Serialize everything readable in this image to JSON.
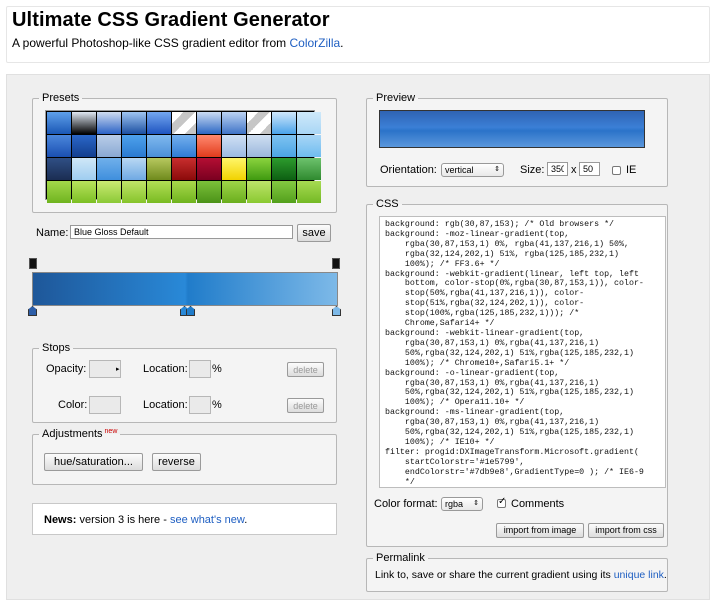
{
  "header": {
    "title": "Ultimate CSS Gradient Generator",
    "subtitle_prefix": "A powerful Photoshop-like CSS gradient editor from ",
    "subtitle_link": "ColorZilla",
    "subtitle_suffix": "."
  },
  "presets": {
    "legend": "Presets",
    "swatches": [
      "linear-gradient(#5fa0ea,#1a57b5)",
      "linear-gradient(#dfe7f2,#000)",
      "linear-gradient(#cfdcf0,#2a62c6)",
      "linear-gradient(#9fc5f2,#1b4fa1)",
      "linear-gradient(#74a7f0,#1e54c0)",
      "linear-gradient(135deg,#fff 25%,#c6c6c6 25%,#c6c6c6 50%,#fff 50%,#fff 75%,#c6c6c6 75%)",
      "linear-gradient(#cbdcf3,#2b67c4)",
      "linear-gradient(#bcd3f3,#3f73c7)",
      "linear-gradient(135deg,#fff 25%,#c6c6c6 25%,#c6c6c6 50%,#fff 50%,#fff 75%,#c6c6c6 75%)",
      "linear-gradient(#cfe7fb,#4aa3ea)",
      "linear-gradient(#cfe9fa,#a9d6f5)",
      "linear-gradient(#4b87dc,#1a4fb1)",
      "linear-gradient(#2b67c8,#123e8e)",
      "linear-gradient(#b9cde8,#8aa9d3)",
      "linear-gradient(#4ea2ec,#2a7ad1)",
      "linear-gradient(#7fb9ef,#4b8fd8)",
      "linear-gradient(#74b0ee,#2f7bd4)",
      "linear-gradient(#ff8a70,#e23b1c)",
      "linear-gradient(#d0e0f4,#9cbbe3)",
      "linear-gradient(#cfdff2,#9bb7dc)",
      "linear-gradient(#7ec3f1,#4ba4e4)",
      "linear-gradient(#a8d6f6,#6fbcef)",
      "linear-gradient(#2f4f85,#1b2d52)",
      "linear-gradient(#cfe7f7,#9fcdf0)",
      "linear-gradient(#70b0eb,#3f8fdd)",
      "linear-gradient(#b9d8f3,#6fa9e3)",
      "linear-gradient(#b7c85f,#6f8a1c)",
      "linear-gradient(#c82e2e,#8b0a0a)",
      "linear-gradient(#b40e33,#7a0020)",
      "linear-gradient(#fff66a,#f1d200)",
      "linear-gradient(#8bd33e,#3f9a10)",
      "linear-gradient(#2d9b2d,#0d5f12)",
      "linear-gradient(#6dc26d,#2f8a2f)",
      "linear-gradient(#a4d84a,#6fb41f)",
      "linear-gradient(#b8e25c,#7cbf24)",
      "linear-gradient(#cbea73,#8bc936)",
      "linear-gradient(#c0e468,#86c42b)",
      "linear-gradient(#b2de55,#79bb22)",
      "linear-gradient(#a9d94b,#6fb31e)",
      "linear-gradient(#7cc13a,#4b9218)",
      "linear-gradient(#9ed548,#6aae1d)",
      "linear-gradient(#bde36a,#8ac931)",
      "linear-gradient(#83c941,#53a01c)",
      "linear-gradient(#a7db52,#74b925)"
    ]
  },
  "editor": {
    "name_label": "Name:",
    "name_value": "Blue Gloss Default",
    "save_label": "save"
  },
  "stops": {
    "legend": "Stops",
    "opacity_label": "Opacity:",
    "location_label": "Location:",
    "percent": "%",
    "color_label": "Color:",
    "delete_label": "delete"
  },
  "adjustments": {
    "legend": "Adjustments",
    "badge": "new",
    "hue_label": "hue/saturation...",
    "reverse_label": "reverse"
  },
  "news": {
    "bold": "News:",
    "text": " version 3 is here - ",
    "link": "see what's new",
    "suffix": "."
  },
  "preview": {
    "legend": "Preview",
    "orientation_label": "Orientation:",
    "orientation_value": "vertical",
    "size_label": "Size:",
    "width": "350",
    "x": "x",
    "height": "50",
    "ie_label": "IE"
  },
  "css": {
    "legend": "CSS",
    "code": "background: rgb(30,87,153); /* Old browsers */\nbackground: -moz-linear-gradient(top,\n    rgba(30,87,153,1) 0%, rgba(41,137,216,1) 50%,\n    rgba(32,124,202,1) 51%, rgba(125,185,232,1)\n    100%); /* FF3.6+ */\nbackground: -webkit-gradient(linear, left top, left\n    bottom, color-stop(0%,rgba(30,87,153,1)), color-\n    stop(50%,rgba(41,137,216,1)), color-\n    stop(51%,rgba(32,124,202,1)), color-\n    stop(100%,rgba(125,185,232,1))); /*\n    Chrome,Safari4+ */\nbackground: -webkit-linear-gradient(top,\n    rgba(30,87,153,1) 0%,rgba(41,137,216,1)\n    50%,rgba(32,124,202,1) 51%,rgba(125,185,232,1)\n    100%); /* Chrome10+,Safari5.1+ */\nbackground: -o-linear-gradient(top,\n    rgba(30,87,153,1) 0%,rgba(41,137,216,1)\n    50%,rgba(32,124,202,1) 51%,rgba(125,185,232,1)\n    100%); /* Opera11.10+ */\nbackground: -ms-linear-gradient(top,\n    rgba(30,87,153,1) 0%,rgba(41,137,216,1)\n    50%,rgba(32,124,202,1) 51%,rgba(125,185,232,1)\n    100%); /* IE10+ */\nfilter: progid:DXImageTransform.Microsoft.gradient(\n    startColorstr='#1e5799',\n    endColorstr='#7db9e8',GradientType=0 ); /* IE6-9\n    */",
    "format_label": "Color format:",
    "format_value": "rgba",
    "comments_label": "Comments",
    "import_image_label": "import from image",
    "import_css_label": "import from css"
  },
  "permalink": {
    "legend": "Permalink",
    "text": "Link to, save or share the current gradient using its ",
    "link": "unique link",
    "suffix": "."
  },
  "colors": {
    "link": "#1f5fc2",
    "stop_color": "#1e5799"
  }
}
